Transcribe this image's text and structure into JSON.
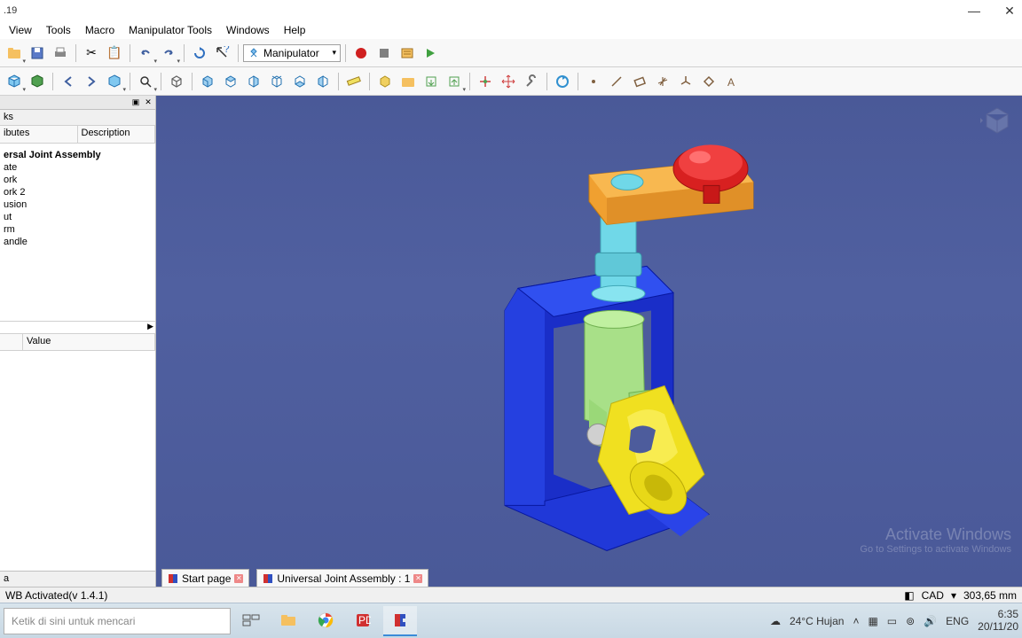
{
  "title_suffix": ".19",
  "menu": [
    "View",
    "Tools",
    "Macro",
    "Manipulator Tools",
    "Windows",
    "Help"
  ],
  "workbench": "Manipulator",
  "side": {
    "tab": "ks",
    "headers": [
      "ibutes",
      "Description"
    ],
    "tree_root": "ersal Joint Assembly",
    "tree_items": [
      "ate",
      "ork",
      "ork 2",
      "usion",
      "ut",
      "rm",
      "andle"
    ],
    "prop_header": "Value",
    "bottom_tab": "a"
  },
  "doc_tabs": {
    "start": "Start page",
    "current": "Universal Joint Assembly : 1"
  },
  "watermark": {
    "big": "Activate Windows",
    "small": "Go to Settings to activate Windows"
  },
  "status": {
    "left": "WB Activated(v 1.4.1)",
    "mode": "CAD",
    "coord": "303,65 mm"
  },
  "taskbar": {
    "search_placeholder": "Ketik di sini untuk mencari",
    "weather": "24°C  Hujan",
    "lang": "ENG",
    "time": "6:35",
    "date": "20/11/20"
  }
}
